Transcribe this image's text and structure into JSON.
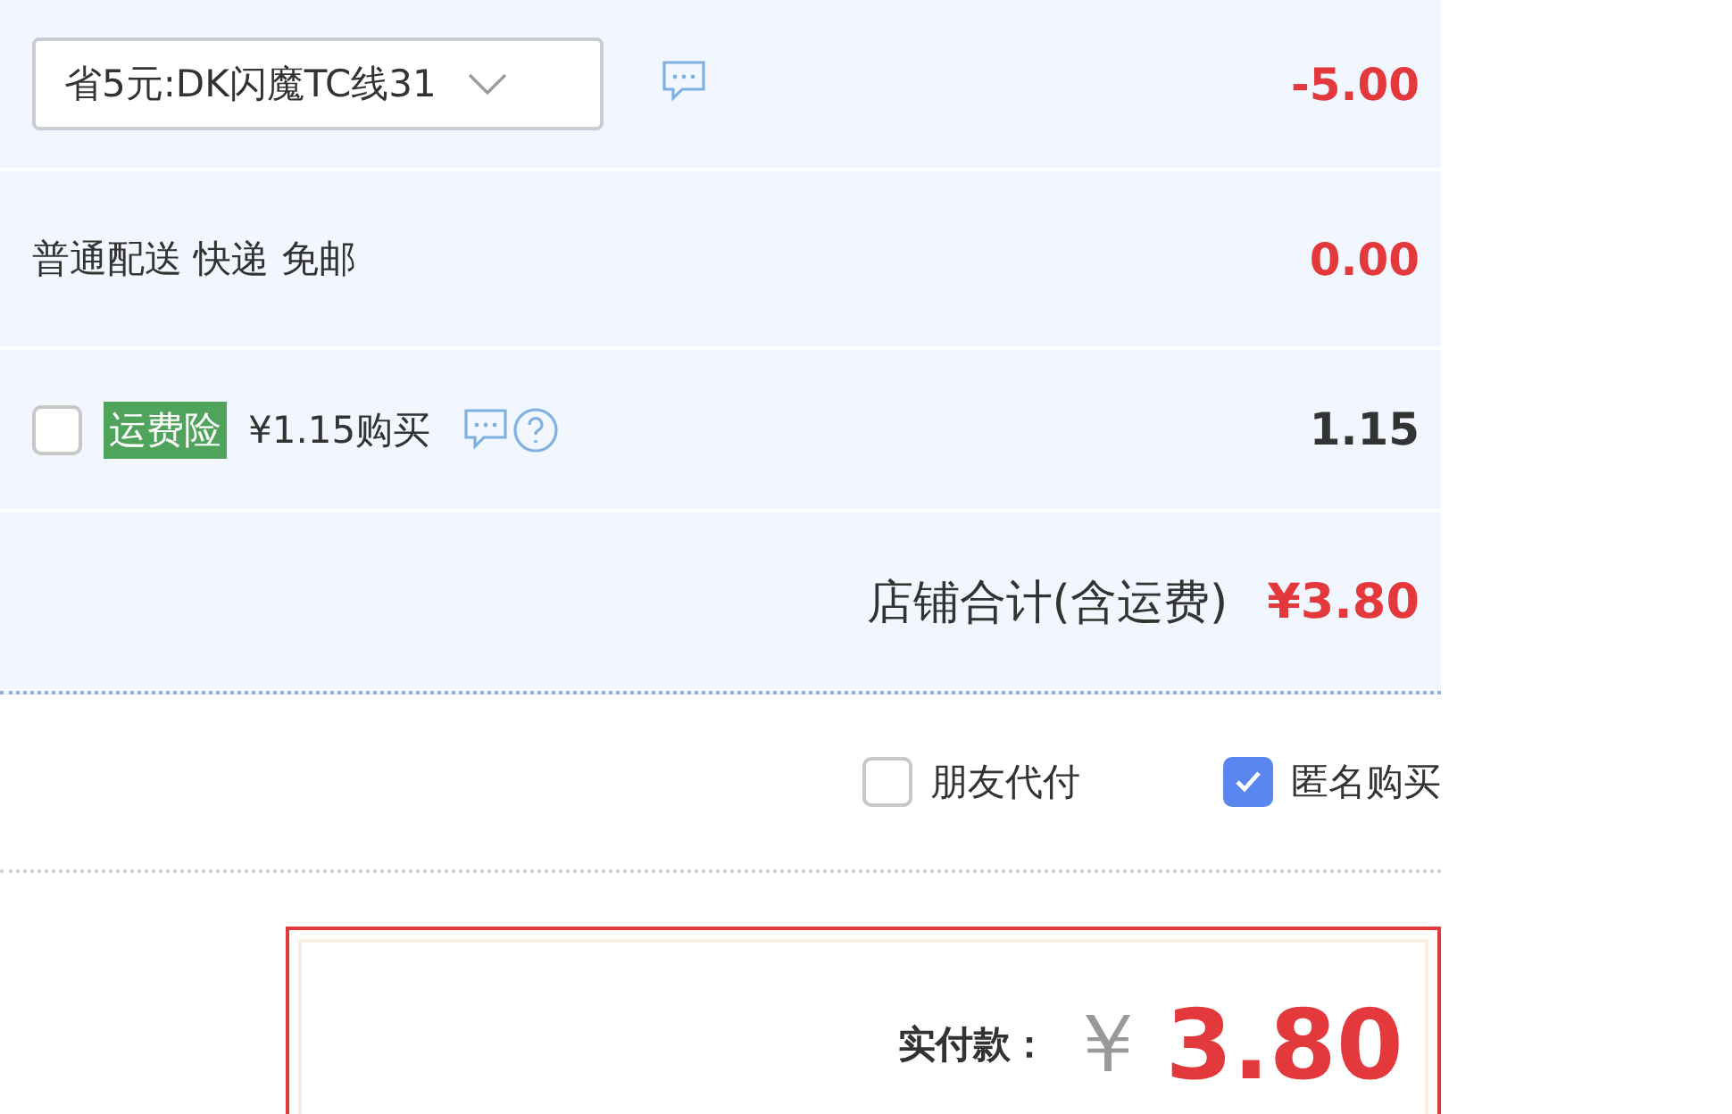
{
  "coupon": {
    "value": "省5元:DK闪魔TC线31",
    "amount": "-5.00"
  },
  "shipping": {
    "label": "普通配送 快递 免邮",
    "amount": "0.00"
  },
  "insurance": {
    "checked": false,
    "tag": "运费险",
    "label": "¥1.15购买",
    "amount": "1.15"
  },
  "shop_total": {
    "label": "店铺合计(含运费)",
    "amount": "¥3.80"
  },
  "options": [
    {
      "label": "朋友代付",
      "checked": false
    },
    {
      "label": "匿名购买",
      "checked": true
    }
  ],
  "payment": {
    "label": "实付款：",
    "currency": "￥",
    "amount": "3.80"
  }
}
